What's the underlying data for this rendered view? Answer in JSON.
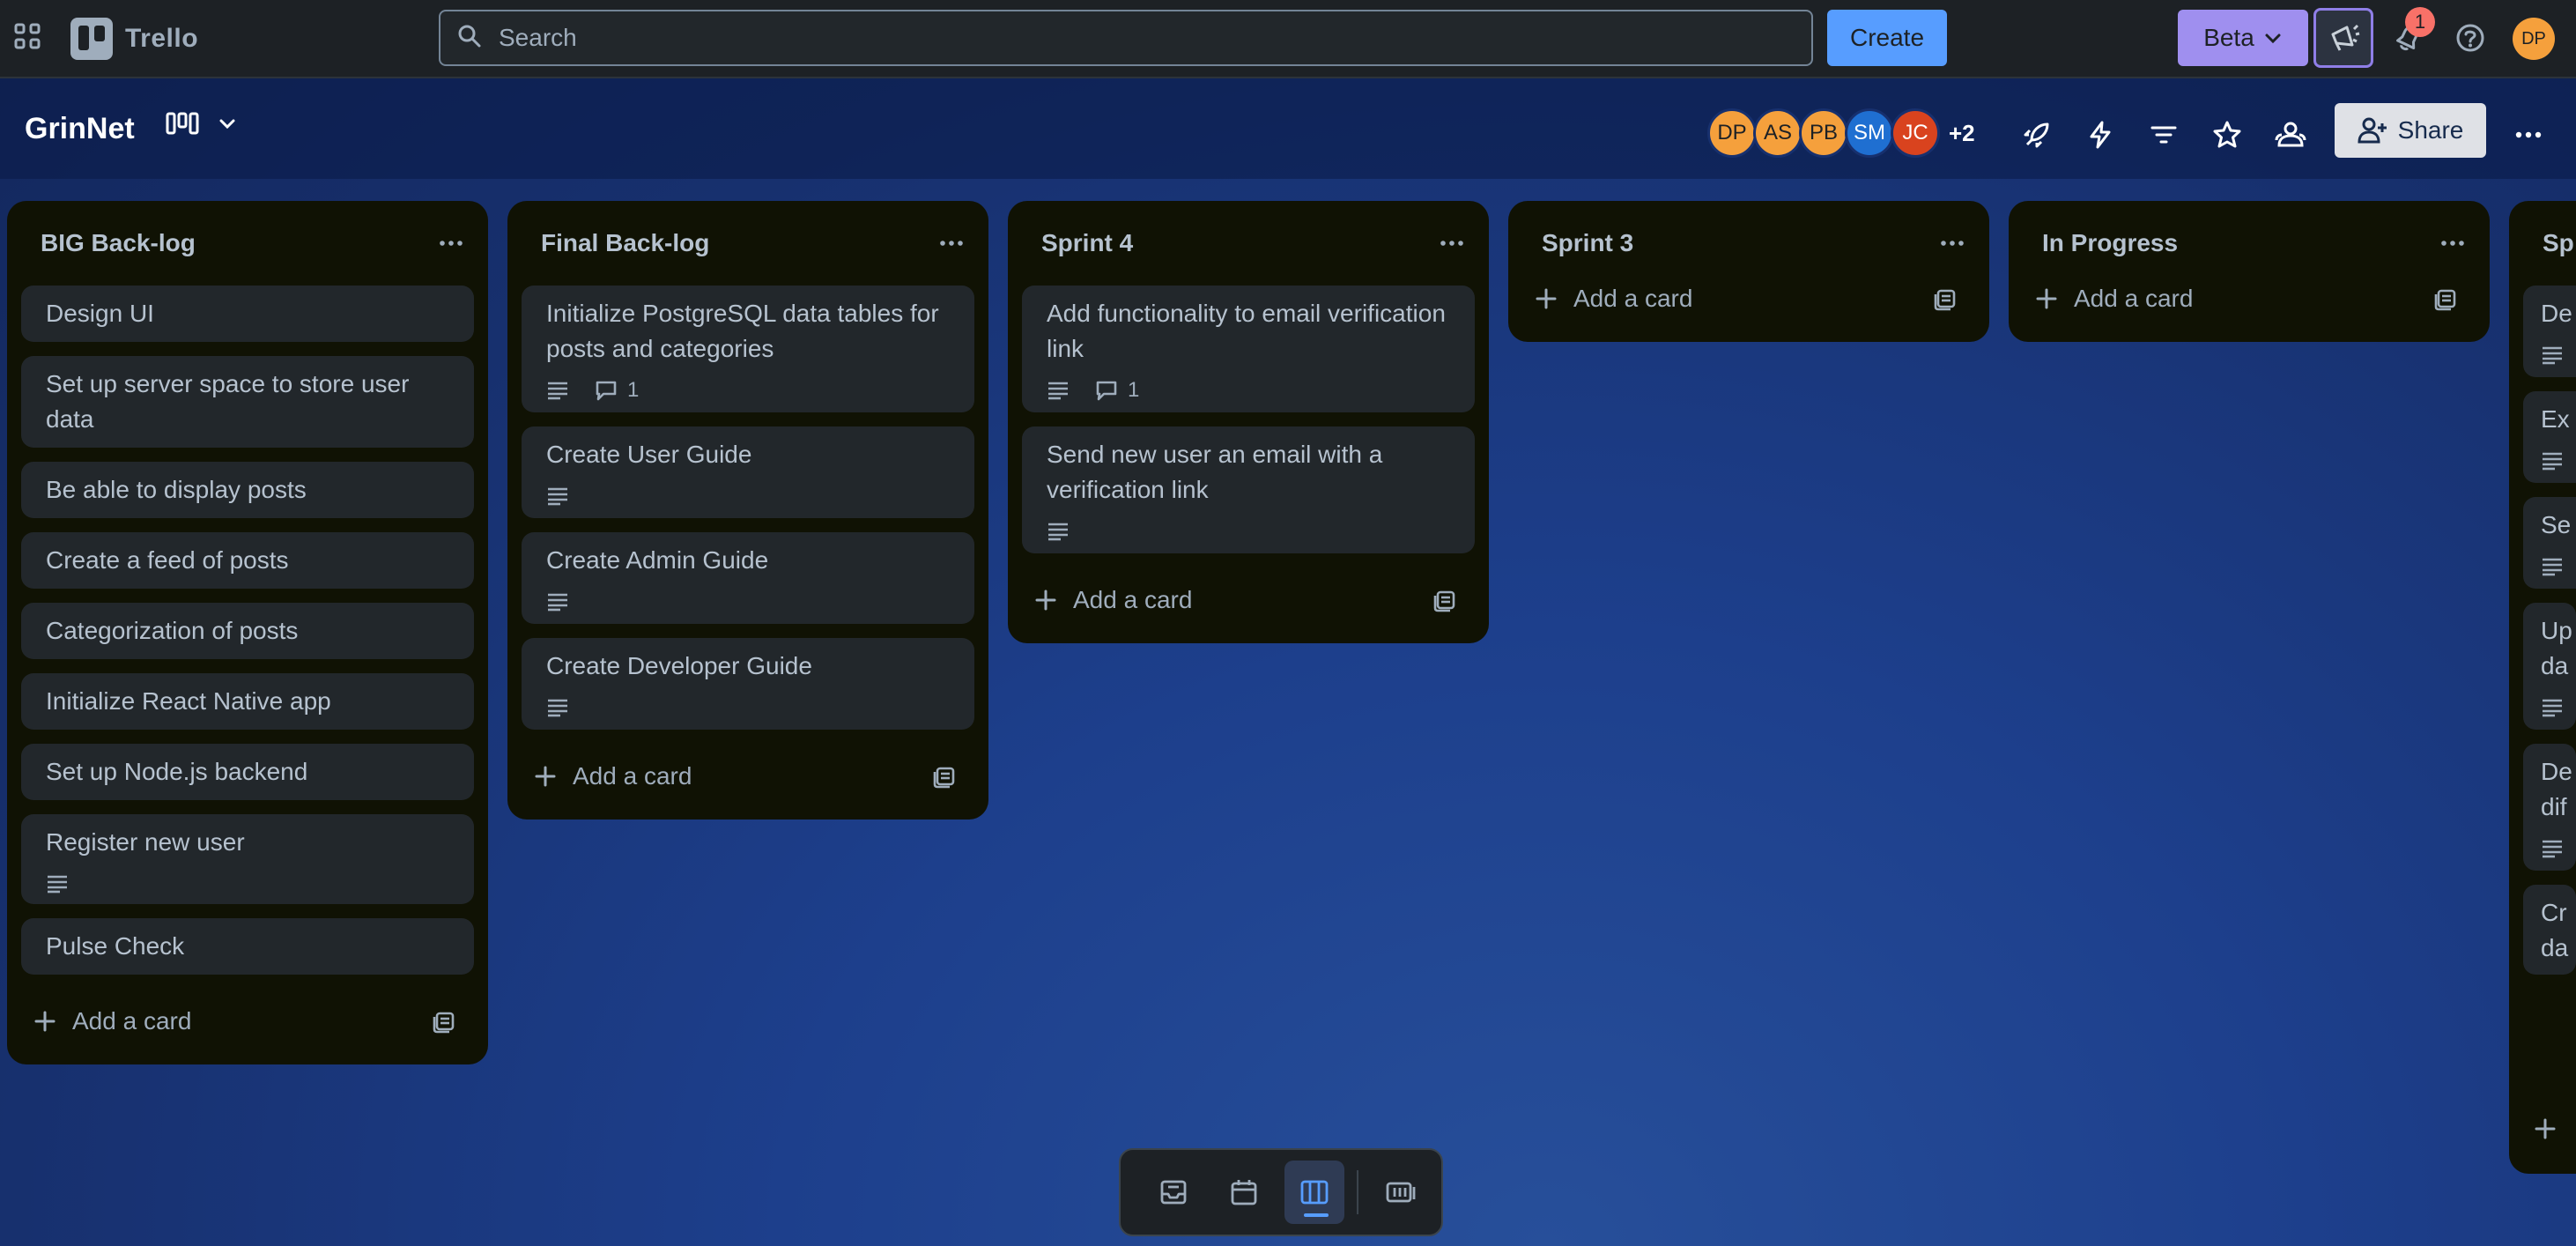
{
  "app": {
    "name": "Trello"
  },
  "topnav": {
    "search_placeholder": "Search",
    "create_label": "Create",
    "beta_label": "Beta",
    "notification_count": "1",
    "user_initials": "DP"
  },
  "board": {
    "title": "GrinNet",
    "members": [
      {
        "initials": "DP",
        "color": "#f5a03c"
      },
      {
        "initials": "AS",
        "color": "#f5a03c"
      },
      {
        "initials": "PB",
        "color": "#f5a03c"
      },
      {
        "initials": "SM",
        "color": "#1f6fd1"
      },
      {
        "initials": "JC",
        "color": "#d9431e"
      }
    ],
    "more_members": "+2",
    "share_label": "Share"
  },
  "lists": [
    {
      "title": "BIG Back-log",
      "cards": [
        {
          "title": "Design UI"
        },
        {
          "title": "Set up server space to store user data"
        },
        {
          "title": "Be able to display posts"
        },
        {
          "title": "Create a feed of posts"
        },
        {
          "title": "Categorization of posts"
        },
        {
          "title": "Initialize React Native app"
        },
        {
          "title": "Set up Node.js backend"
        },
        {
          "title": "Register new user",
          "description": true
        },
        {
          "title": "Pulse Check"
        }
      ],
      "add_label": "Add a card"
    },
    {
      "title": "Final Back-log",
      "cards": [
        {
          "title": "Initialize PostgreSQL data tables for posts and categories",
          "description": true,
          "comments": "1"
        },
        {
          "title": "Create User Guide",
          "description": true
        },
        {
          "title": "Create Admin Guide",
          "description": true
        },
        {
          "title": "Create Developer Guide",
          "description": true
        }
      ],
      "add_label": "Add a card"
    },
    {
      "title": "Sprint 4",
      "cards": [
        {
          "title": "Add functionality to email verification link",
          "description": true,
          "comments": "1"
        },
        {
          "title": "Send new user an email with a verification link",
          "description": true
        }
      ],
      "add_label": "Add a card"
    },
    {
      "title": "Sprint 3",
      "cards": [],
      "add_label": "Add a card"
    },
    {
      "title": "In Progress",
      "cards": [],
      "add_label": "Add a card"
    },
    {
      "title": "Sp",
      "cards": [
        {
          "title": "De",
          "description": true
        },
        {
          "title": "Ex",
          "description": true
        },
        {
          "title": "Se",
          "description": true
        },
        {
          "title": "Up da",
          "description": true
        },
        {
          "title": "De dif",
          "description": true
        },
        {
          "title": "Cr da"
        }
      ]
    }
  ]
}
